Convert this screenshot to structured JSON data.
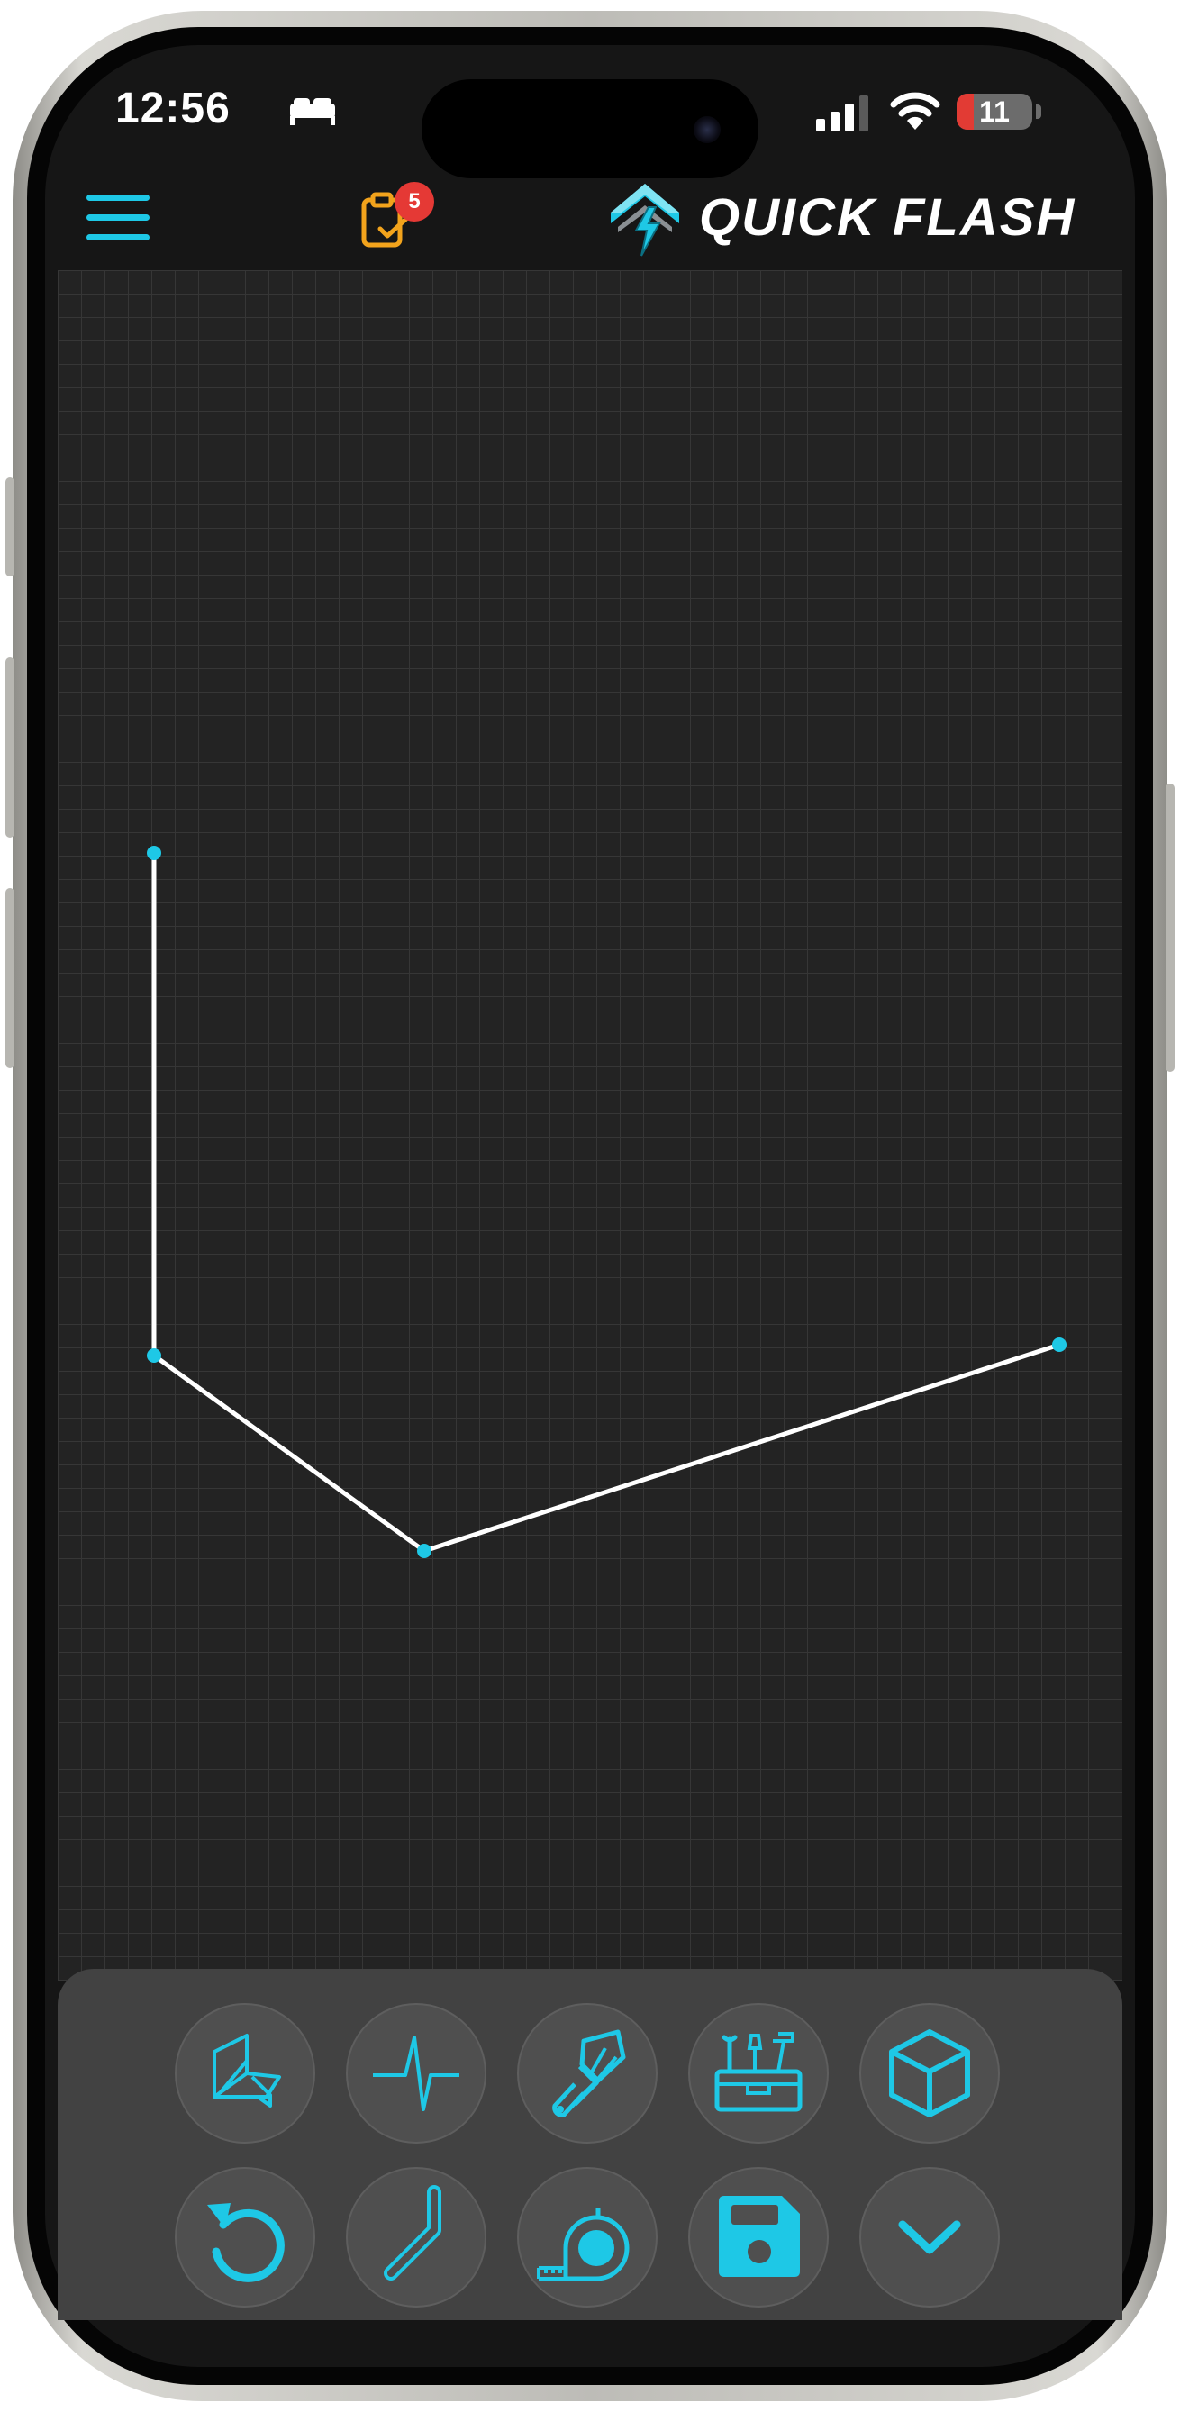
{
  "status_bar": {
    "time": "12:56",
    "sleep_icon": "bed-icon",
    "battery_level": "11",
    "battery_percent": 11
  },
  "header": {
    "menu_icon": "hamburger-menu-icon",
    "tasks_icon": "clipboard-check-icon",
    "tasks_badge": "5",
    "brand": "QUICK FLASH",
    "accent_color": "#1ec8e6",
    "task_icon_color": "#f2a31c",
    "badge_color": "#e53935"
  },
  "canvas": {
    "line_color": "#ffffff",
    "node_color": "#1ec8e6",
    "path_points": [
      {
        "id": "p1"
      },
      {
        "id": "p2"
      },
      {
        "id": "p3"
      },
      {
        "id": "p4"
      }
    ]
  },
  "toolbar": {
    "row1": [
      "fold-sheet-icon",
      "pulse-line-icon",
      "paint-brush-icon",
      "toolbox-icon",
      "cube-icon"
    ],
    "row2": [
      "undo-icon",
      "bend-line-icon",
      "tape-measure-icon",
      "save-disk-icon",
      "chevron-down-icon"
    ]
  }
}
